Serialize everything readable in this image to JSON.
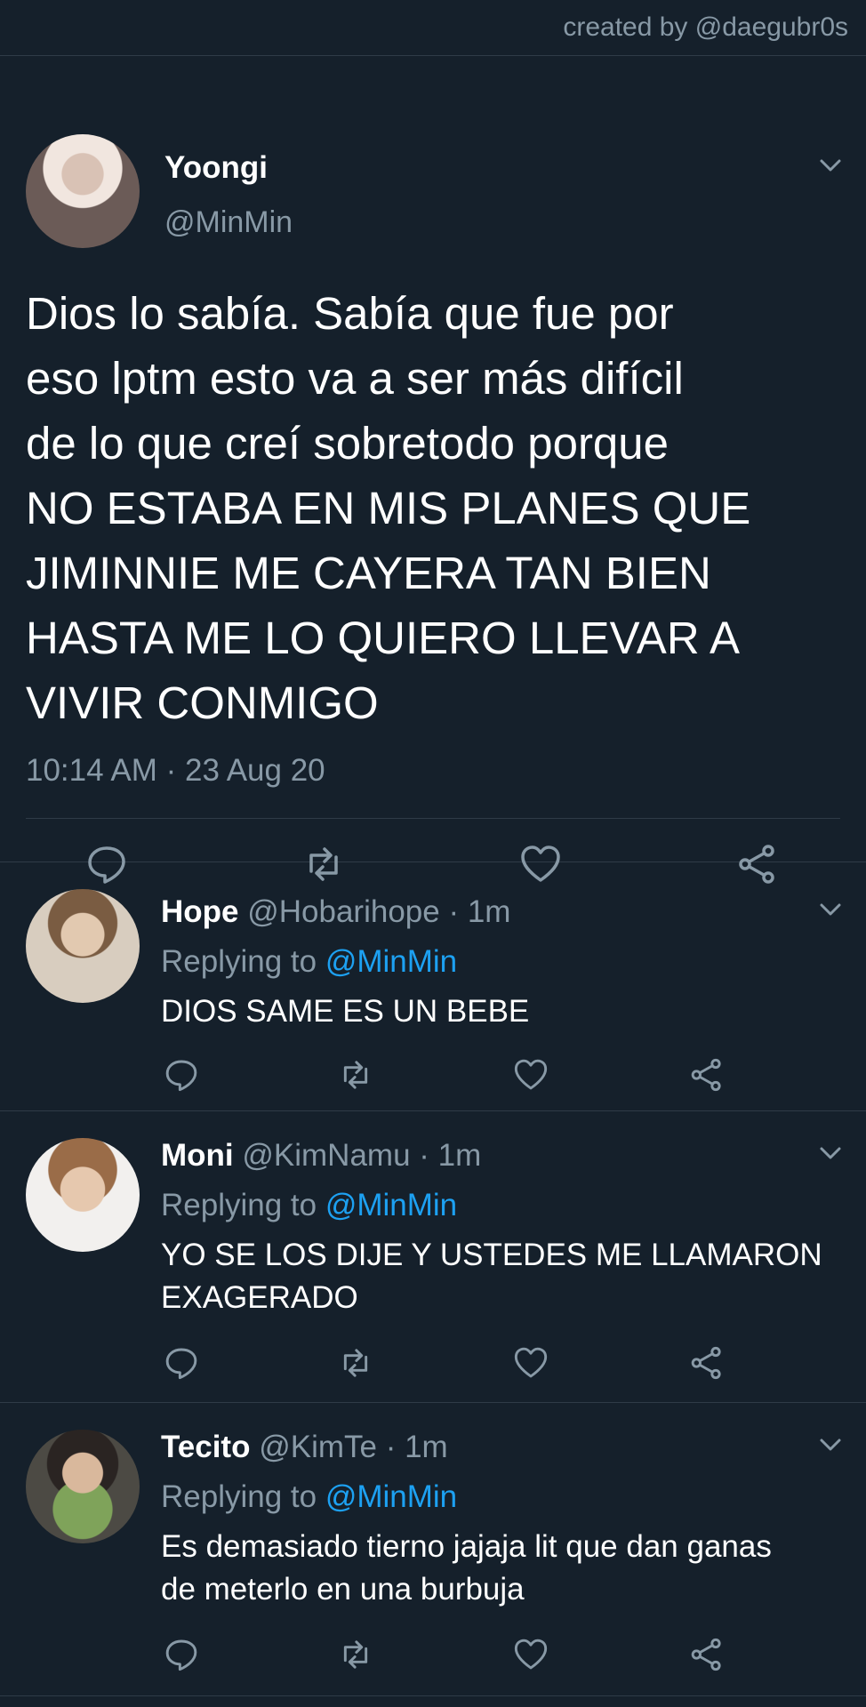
{
  "credit": "created by @daegubr0s",
  "main": {
    "name": "Yoongi",
    "handle": "@MinMin",
    "text": "Dios lo sabía. Sabía que fue por\neso lptm esto va a ser más difícil\nde lo que creí sobretodo porque\nNO ESTABA EN MIS PLANES QUE\nJIMINNIE ME CAYERA TAN BIEN\nHASTA ME LO QUIERO LLEVAR A\nVIVIR CONMIGO",
    "timestamp": "10:14 AM · 23 Aug 20"
  },
  "replies": [
    {
      "name": "Hope",
      "meta": " @Hobarihope · 1m",
      "replying_label": "Replying to ",
      "replying_to": "@MinMin",
      "text": "DIOS SAME ES UN BEBE"
    },
    {
      "name": "Moni",
      "meta": " @KimNamu · 1m",
      "replying_label": "Replying to ",
      "replying_to": "@MinMin",
      "text": "YO SE LOS DIJE Y USTEDES ME LLAMARON\nEXAGERADO"
    },
    {
      "name": "Tecito",
      "meta": " @KimTe · 1m",
      "replying_label": "Replying to ",
      "replying_to": "@MinMin",
      "text": "Es demasiado tierno jajaja lit que dan ganas\nde meterlo en una burbuja"
    }
  ],
  "icons": [
    "reply-icon",
    "retweet-icon",
    "like-icon",
    "share-icon",
    "chevron-down-icon"
  ],
  "colors": {
    "background": "#15202b",
    "secondary_text": "#8899a6",
    "link": "#1da1f2",
    "divider": "#2f3b47"
  }
}
